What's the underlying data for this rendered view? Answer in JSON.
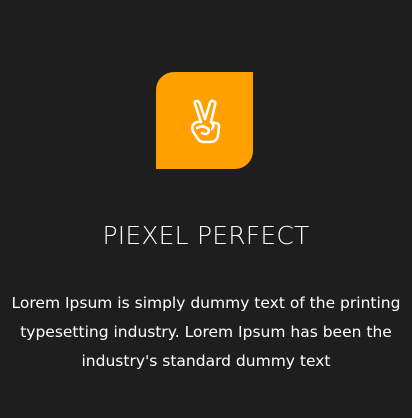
{
  "feature": {
    "icon": "peace-hand-icon",
    "title": "PIEXEL PERFECT",
    "description_lines": [
      "Lorem Ipsum is simply dummy text of the printing",
      "typesetting industry. Lorem Ipsum has been the",
      "industry's standard dummy text"
    ]
  },
  "colors": {
    "background": "#1e1e1e",
    "accent": "#ff9f00",
    "text": "#ffffff"
  }
}
